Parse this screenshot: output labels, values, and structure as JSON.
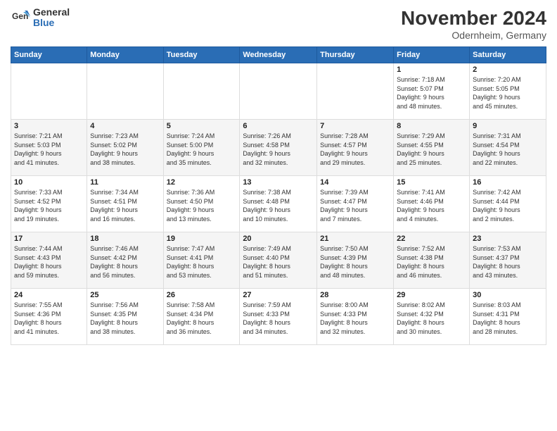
{
  "logo": {
    "general": "General",
    "blue": "Blue"
  },
  "title": "November 2024",
  "subtitle": "Odernheim, Germany",
  "days_of_week": [
    "Sunday",
    "Monday",
    "Tuesday",
    "Wednesday",
    "Thursday",
    "Friday",
    "Saturday"
  ],
  "weeks": [
    [
      {
        "day": "",
        "info": ""
      },
      {
        "day": "",
        "info": ""
      },
      {
        "day": "",
        "info": ""
      },
      {
        "day": "",
        "info": ""
      },
      {
        "day": "",
        "info": ""
      },
      {
        "day": "1",
        "info": "Sunrise: 7:18 AM\nSunset: 5:07 PM\nDaylight: 9 hours\nand 48 minutes."
      },
      {
        "day": "2",
        "info": "Sunrise: 7:20 AM\nSunset: 5:05 PM\nDaylight: 9 hours\nand 45 minutes."
      }
    ],
    [
      {
        "day": "3",
        "info": "Sunrise: 7:21 AM\nSunset: 5:03 PM\nDaylight: 9 hours\nand 41 minutes."
      },
      {
        "day": "4",
        "info": "Sunrise: 7:23 AM\nSunset: 5:02 PM\nDaylight: 9 hours\nand 38 minutes."
      },
      {
        "day": "5",
        "info": "Sunrise: 7:24 AM\nSunset: 5:00 PM\nDaylight: 9 hours\nand 35 minutes."
      },
      {
        "day": "6",
        "info": "Sunrise: 7:26 AM\nSunset: 4:58 PM\nDaylight: 9 hours\nand 32 minutes."
      },
      {
        "day": "7",
        "info": "Sunrise: 7:28 AM\nSunset: 4:57 PM\nDaylight: 9 hours\nand 29 minutes."
      },
      {
        "day": "8",
        "info": "Sunrise: 7:29 AM\nSunset: 4:55 PM\nDaylight: 9 hours\nand 25 minutes."
      },
      {
        "day": "9",
        "info": "Sunrise: 7:31 AM\nSunset: 4:54 PM\nDaylight: 9 hours\nand 22 minutes."
      }
    ],
    [
      {
        "day": "10",
        "info": "Sunrise: 7:33 AM\nSunset: 4:52 PM\nDaylight: 9 hours\nand 19 minutes."
      },
      {
        "day": "11",
        "info": "Sunrise: 7:34 AM\nSunset: 4:51 PM\nDaylight: 9 hours\nand 16 minutes."
      },
      {
        "day": "12",
        "info": "Sunrise: 7:36 AM\nSunset: 4:50 PM\nDaylight: 9 hours\nand 13 minutes."
      },
      {
        "day": "13",
        "info": "Sunrise: 7:38 AM\nSunset: 4:48 PM\nDaylight: 9 hours\nand 10 minutes."
      },
      {
        "day": "14",
        "info": "Sunrise: 7:39 AM\nSunset: 4:47 PM\nDaylight: 9 hours\nand 7 minutes."
      },
      {
        "day": "15",
        "info": "Sunrise: 7:41 AM\nSunset: 4:46 PM\nDaylight: 9 hours\nand 4 minutes."
      },
      {
        "day": "16",
        "info": "Sunrise: 7:42 AM\nSunset: 4:44 PM\nDaylight: 9 hours\nand 2 minutes."
      }
    ],
    [
      {
        "day": "17",
        "info": "Sunrise: 7:44 AM\nSunset: 4:43 PM\nDaylight: 8 hours\nand 59 minutes."
      },
      {
        "day": "18",
        "info": "Sunrise: 7:46 AM\nSunset: 4:42 PM\nDaylight: 8 hours\nand 56 minutes."
      },
      {
        "day": "19",
        "info": "Sunrise: 7:47 AM\nSunset: 4:41 PM\nDaylight: 8 hours\nand 53 minutes."
      },
      {
        "day": "20",
        "info": "Sunrise: 7:49 AM\nSunset: 4:40 PM\nDaylight: 8 hours\nand 51 minutes."
      },
      {
        "day": "21",
        "info": "Sunrise: 7:50 AM\nSunset: 4:39 PM\nDaylight: 8 hours\nand 48 minutes."
      },
      {
        "day": "22",
        "info": "Sunrise: 7:52 AM\nSunset: 4:38 PM\nDaylight: 8 hours\nand 46 minutes."
      },
      {
        "day": "23",
        "info": "Sunrise: 7:53 AM\nSunset: 4:37 PM\nDaylight: 8 hours\nand 43 minutes."
      }
    ],
    [
      {
        "day": "24",
        "info": "Sunrise: 7:55 AM\nSunset: 4:36 PM\nDaylight: 8 hours\nand 41 minutes."
      },
      {
        "day": "25",
        "info": "Sunrise: 7:56 AM\nSunset: 4:35 PM\nDaylight: 8 hours\nand 38 minutes."
      },
      {
        "day": "26",
        "info": "Sunrise: 7:58 AM\nSunset: 4:34 PM\nDaylight: 8 hours\nand 36 minutes."
      },
      {
        "day": "27",
        "info": "Sunrise: 7:59 AM\nSunset: 4:33 PM\nDaylight: 8 hours\nand 34 minutes."
      },
      {
        "day": "28",
        "info": "Sunrise: 8:00 AM\nSunset: 4:33 PM\nDaylight: 8 hours\nand 32 minutes."
      },
      {
        "day": "29",
        "info": "Sunrise: 8:02 AM\nSunset: 4:32 PM\nDaylight: 8 hours\nand 30 minutes."
      },
      {
        "day": "30",
        "info": "Sunrise: 8:03 AM\nSunset: 4:31 PM\nDaylight: 8 hours\nand 28 minutes."
      }
    ]
  ]
}
